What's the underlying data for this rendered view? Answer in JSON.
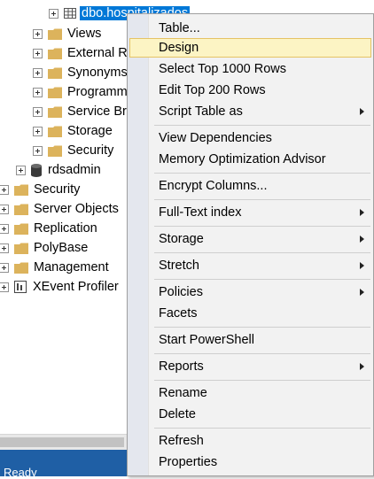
{
  "tree": {
    "selected_table": "dbo.hospitalizados",
    "db_children": [
      "Views",
      "External Re",
      "Synonyms",
      "Programm",
      "Service Bro",
      "Storage",
      "Security"
    ],
    "database": "rdsadmin",
    "server_children": [
      "Security",
      "Server Objects",
      "Replication",
      "PolyBase",
      "Management",
      "XEvent Profiler"
    ]
  },
  "status": {
    "text": "Ready"
  },
  "menu": {
    "items": [
      {
        "label": "Table...",
        "submenu": false
      },
      {
        "label": "Design",
        "submenu": false,
        "highlighted": true
      },
      {
        "label": "Select Top 1000 Rows",
        "submenu": false
      },
      {
        "label": "Edit Top 200 Rows",
        "submenu": false
      },
      {
        "label": "Script Table as",
        "submenu": true
      },
      {
        "label": "View Dependencies",
        "submenu": false
      },
      {
        "label": "Memory Optimization Advisor",
        "submenu": false
      },
      {
        "label": "Encrypt Columns...",
        "submenu": false
      },
      {
        "label": "Full-Text index",
        "submenu": true
      },
      {
        "label": "Storage",
        "submenu": true
      },
      {
        "label": "Stretch",
        "submenu": true
      },
      {
        "label": "Policies",
        "submenu": true
      },
      {
        "label": "Facets",
        "submenu": false
      },
      {
        "label": "Start PowerShell",
        "submenu": false
      },
      {
        "label": "Reports",
        "submenu": true
      },
      {
        "label": "Rename",
        "submenu": false
      },
      {
        "label": "Delete",
        "submenu": false
      },
      {
        "label": "Refresh",
        "submenu": false
      },
      {
        "label": "Properties",
        "submenu": false
      }
    ]
  },
  "colors": {
    "folder": "#dcb35c",
    "selection": "#0078d7",
    "highlight_bg": "#fcf4c4",
    "highlight_border": "#e5c365",
    "statusbar": "#1f5fa5"
  }
}
